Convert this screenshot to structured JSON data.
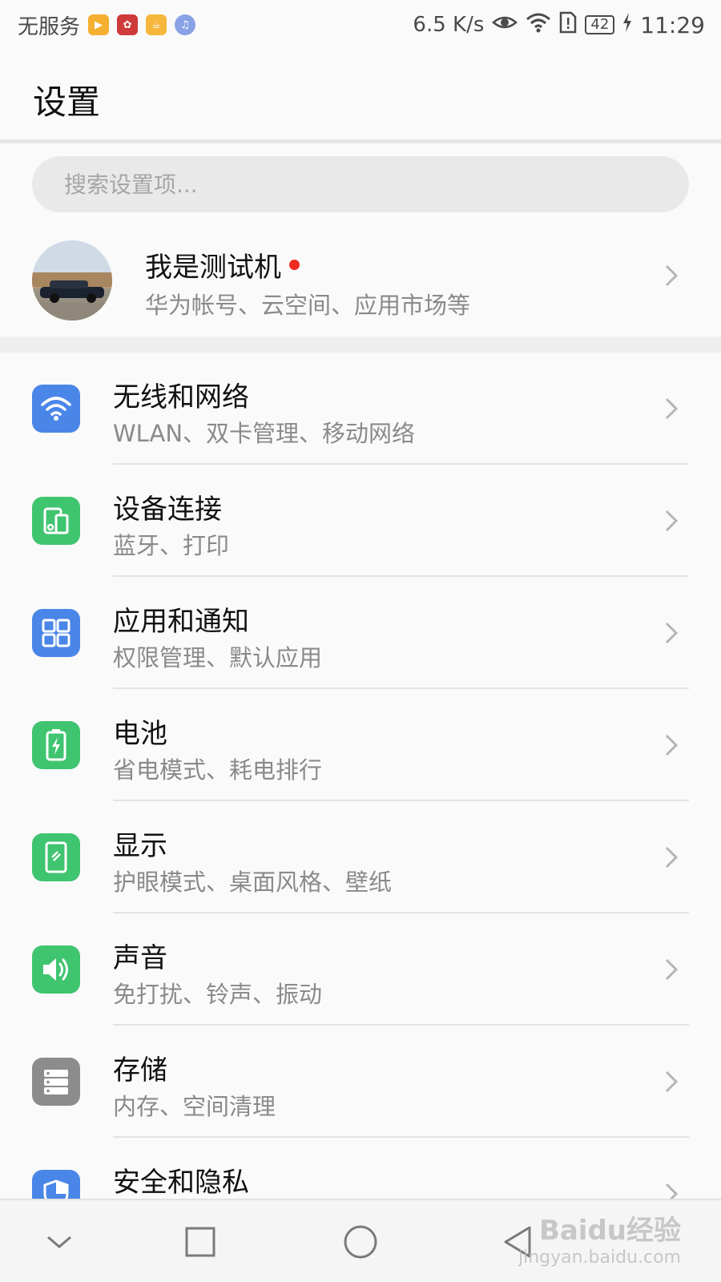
{
  "status_bar": {
    "carrier": "无服务",
    "net_speed": "6.5 K/s",
    "battery_level": "42",
    "time": "11:29"
  },
  "header": {
    "title": "设置"
  },
  "search": {
    "placeholder": "搜索设置项..."
  },
  "account": {
    "name": "我是测试机",
    "subtitle": "华为帐号、云空间、应用市场等"
  },
  "settings": [
    {
      "title": "无线和网络",
      "subtitle": "WLAN、双卡管理、移动网络",
      "icon": "wifi-icon",
      "color": "#4a86e8"
    },
    {
      "title": "设备连接",
      "subtitle": "蓝牙、打印",
      "icon": "device-connection-icon",
      "color": "#3fc470"
    },
    {
      "title": "应用和通知",
      "subtitle": "权限管理、默认应用",
      "icon": "apps-grid-icon",
      "color": "#4a86e8"
    },
    {
      "title": "电池",
      "subtitle": "省电模式、耗电排行",
      "icon": "battery-icon",
      "color": "#3fc470"
    },
    {
      "title": "显示",
      "subtitle": "护眼模式、桌面风格、壁纸",
      "icon": "display-icon",
      "color": "#3fc470"
    },
    {
      "title": "声音",
      "subtitle": "免打扰、铃声、振动",
      "icon": "speaker-icon",
      "color": "#3fc470"
    },
    {
      "title": "存储",
      "subtitle": "内存、空间清理",
      "icon": "storage-icon",
      "color": "#8c8c8c"
    },
    {
      "title": "安全和隐私",
      "subtitle": "",
      "icon": "shield-icon",
      "color": "#4a86e8"
    }
  ],
  "watermark": {
    "brand": "Baidu经验",
    "url": "jingyan.baidu.com"
  }
}
